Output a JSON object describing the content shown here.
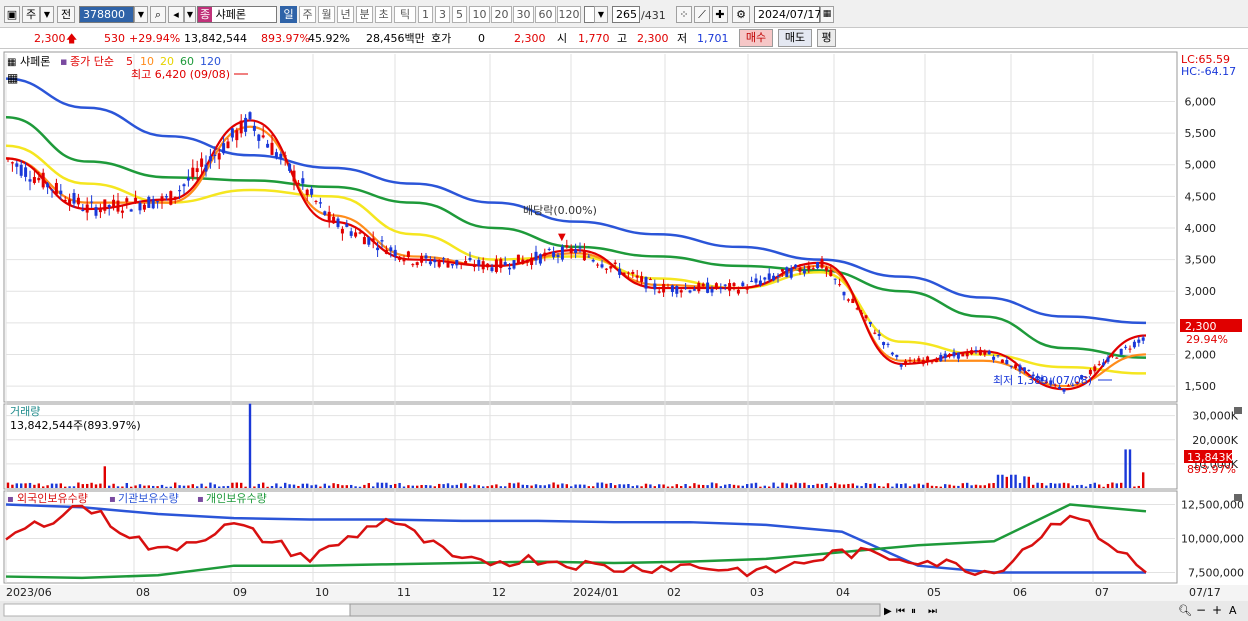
{
  "toolbar": {
    "market": "주",
    "type": "전",
    "code": "378800",
    "stock_name": "샤페론",
    "stock_badge": "종",
    "periods": [
      "일",
      "주",
      "월",
      "년",
      "분",
      "초",
      "틱"
    ],
    "active_period": "일",
    "intervals": [
      "1",
      "3",
      "5",
      "10",
      "20",
      "30",
      "60",
      "120"
    ],
    "count": "265",
    "total": "/431",
    "date": "2024/07/17"
  },
  "quote": {
    "price": "2,300",
    "change": "530",
    "change_pct": "+29.94%",
    "volume": "13,842,544",
    "volume_ratio": "893.97%",
    "turnover": "45.92%",
    "amount": "28,456백만",
    "hoga_label": "호가",
    "hoga_value": "0",
    "hoga_price": "2,300",
    "open_label": "시",
    "open": "1,770",
    "high_label": "고",
    "high": "2,300",
    "low_label": "저",
    "low": "1,701",
    "buy_label": "매수",
    "sell_label": "매도",
    "avg_label": "평"
  },
  "chart_data": {
    "type": "line",
    "legend": {
      "name": "샤페론",
      "ma_label": "종가 단순",
      "ma_periods": [
        "5",
        "10",
        "20",
        "60",
        "120"
      ]
    },
    "annotations": {
      "high": "최고 6,420 (09/08)",
      "low": "최저 1,389 (07/08)",
      "dividend": "배당락(0.00%)",
      "lc": "LC:65.59",
      "hc": "HC:-64.17"
    },
    "colors": {
      "ma5": "#e00000",
      "ma10": "#ff8c1a",
      "ma20": "#f5e620",
      "ma60": "#1e9a3a",
      "ma120": "#2b55d8",
      "up": "#e00000",
      "down": "#1a38d8"
    },
    "x_ticks": [
      "2023/06",
      "08",
      "09",
      "10",
      "11",
      "12",
      "2024/01",
      "02",
      "03",
      "04",
      "05",
      "06",
      "07",
      "07/17"
    ],
    "price_ticks": [
      "6,000",
      "5,500",
      "5,000",
      "4,500",
      "4,000",
      "3,500",
      "3,000",
      "2,500",
      "2,000",
      "1,500"
    ],
    "price_ylim": [
      1280,
      6750
    ],
    "last_price_tag": "2,300",
    "last_pct_tag": "29.94%",
    "price_series": {
      "dates": [
        "2023/06",
        "07",
        "08",
        "09",
        "10",
        "11",
        "12",
        "2024/01",
        "02",
        "03",
        "04",
        "05",
        "06",
        "07",
        "07/17"
      ],
      "ma120": [
        6360,
        5900,
        5450,
        5150,
        4950,
        4700,
        4400,
        4100,
        3900,
        3700,
        3500,
        3230,
        2900,
        2600,
        2500
      ],
      "ma60": [
        5750,
        5050,
        4800,
        4750,
        4650,
        4400,
        4000,
        3700,
        3550,
        3400,
        3330,
        3000,
        2600,
        2100,
        1950
      ],
      "ma20": [
        5300,
        4700,
        4400,
        4600,
        4500,
        3900,
        3500,
        3550,
        3200,
        3050,
        3300,
        2200,
        2000,
        1800,
        1700
      ],
      "ma5": [
        5100,
        4400,
        4400,
        5600,
        4200,
        3550,
        3400,
        3600,
        3100,
        3050,
        3400,
        1900,
        1900,
        1500,
        2000
      ],
      "close": [
        5100,
        4300,
        4450,
        5700,
        4100,
        3500,
        3400,
        3650,
        3050,
        3050,
        3450,
        1850,
        2050,
        1450,
        2300
      ]
    },
    "volume": {
      "label": "거래량",
      "value": "13,842,544주(893.97%)",
      "ticks": [
        "30,000K",
        "20,000K",
        "10,000K"
      ],
      "last_tag": "13,843K",
      "last_pct": "893.97%"
    },
    "holdings": {
      "series": [
        {
          "name": "외국인보유수량",
          "color": "#d81010"
        },
        {
          "name": "기관보유수량",
          "color": "#2b55d8"
        },
        {
          "name": "개인보유수량",
          "color": "#1e9a3a"
        }
      ],
      "ticks": [
        "12,500,000",
        "10,000,000",
        "7,500,000"
      ],
      "foreign": [
        10000000,
        12500000,
        9000000,
        11000000,
        8500000,
        11500000,
        8200000,
        8500000,
        7800000,
        8000000,
        7500000,
        9000000,
        8500000,
        7500000,
        12000000,
        7500000
      ],
      "institution": [
        12500000,
        12300000,
        11800000,
        11500000,
        11400000,
        11400000,
        11300000,
        11300000,
        11200000,
        11200000,
        11000000,
        10500000,
        8000000,
        7500000,
        7500000,
        7500000
      ],
      "individual": [
        7200000,
        7100000,
        7300000,
        8000000,
        8000000,
        8100000,
        8200000,
        8300000,
        8200000,
        8300000,
        8500000,
        9000000,
        9500000,
        9800000,
        12500000,
        12000000
      ]
    }
  }
}
